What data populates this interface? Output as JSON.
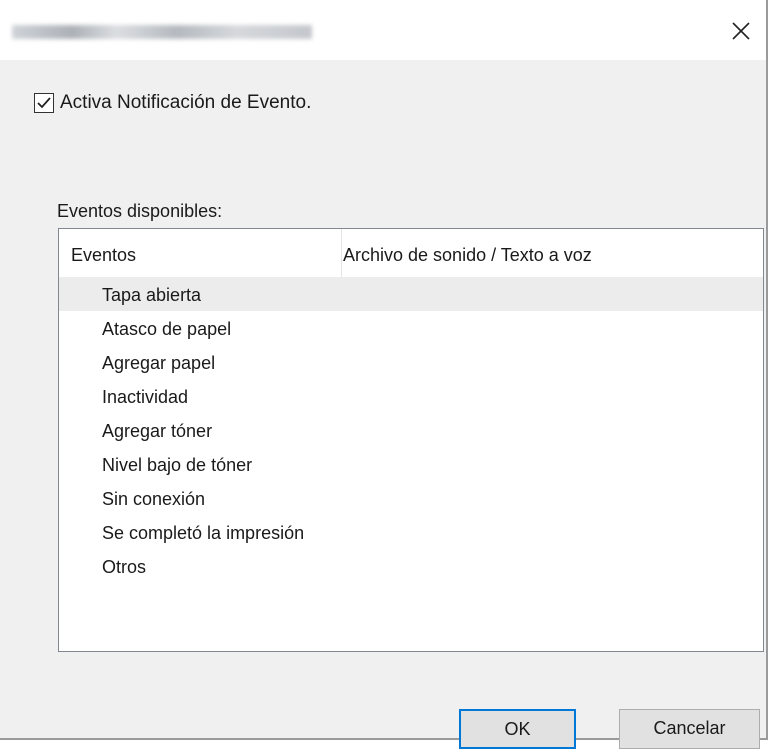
{
  "dialog": {
    "close_symbol": "✕",
    "enable_checkbox": {
      "label": "Activa Notificación de Evento.",
      "checked": true
    },
    "group_label": "Eventos disponibles:",
    "list": {
      "columns": [
        "Eventos",
        "Archivo de sonido / Texto a voz"
      ],
      "rows": [
        {
          "event": "Tapa abierta",
          "sound": "",
          "selected": true
        },
        {
          "event": "Atasco de papel",
          "sound": ""
        },
        {
          "event": "Agregar papel",
          "sound": ""
        },
        {
          "event": "Inactividad",
          "sound": ""
        },
        {
          "event": "Agregar tóner",
          "sound": ""
        },
        {
          "event": "Nivel bajo de tóner",
          "sound": ""
        },
        {
          "event": "Sin conexión",
          "sound": ""
        },
        {
          "event": "Se completó la impresión",
          "sound": ""
        },
        {
          "event": "Otros",
          "sound": ""
        }
      ]
    },
    "buttons": {
      "ok": "OK",
      "cancel": "Cancelar"
    }
  },
  "colors": {
    "accent": "#0078d7",
    "dialog_bg": "#f0f0f0",
    "selected_row": "#ececec"
  },
  "icons": {
    "close": "close-icon",
    "check": "checkmark-icon"
  }
}
